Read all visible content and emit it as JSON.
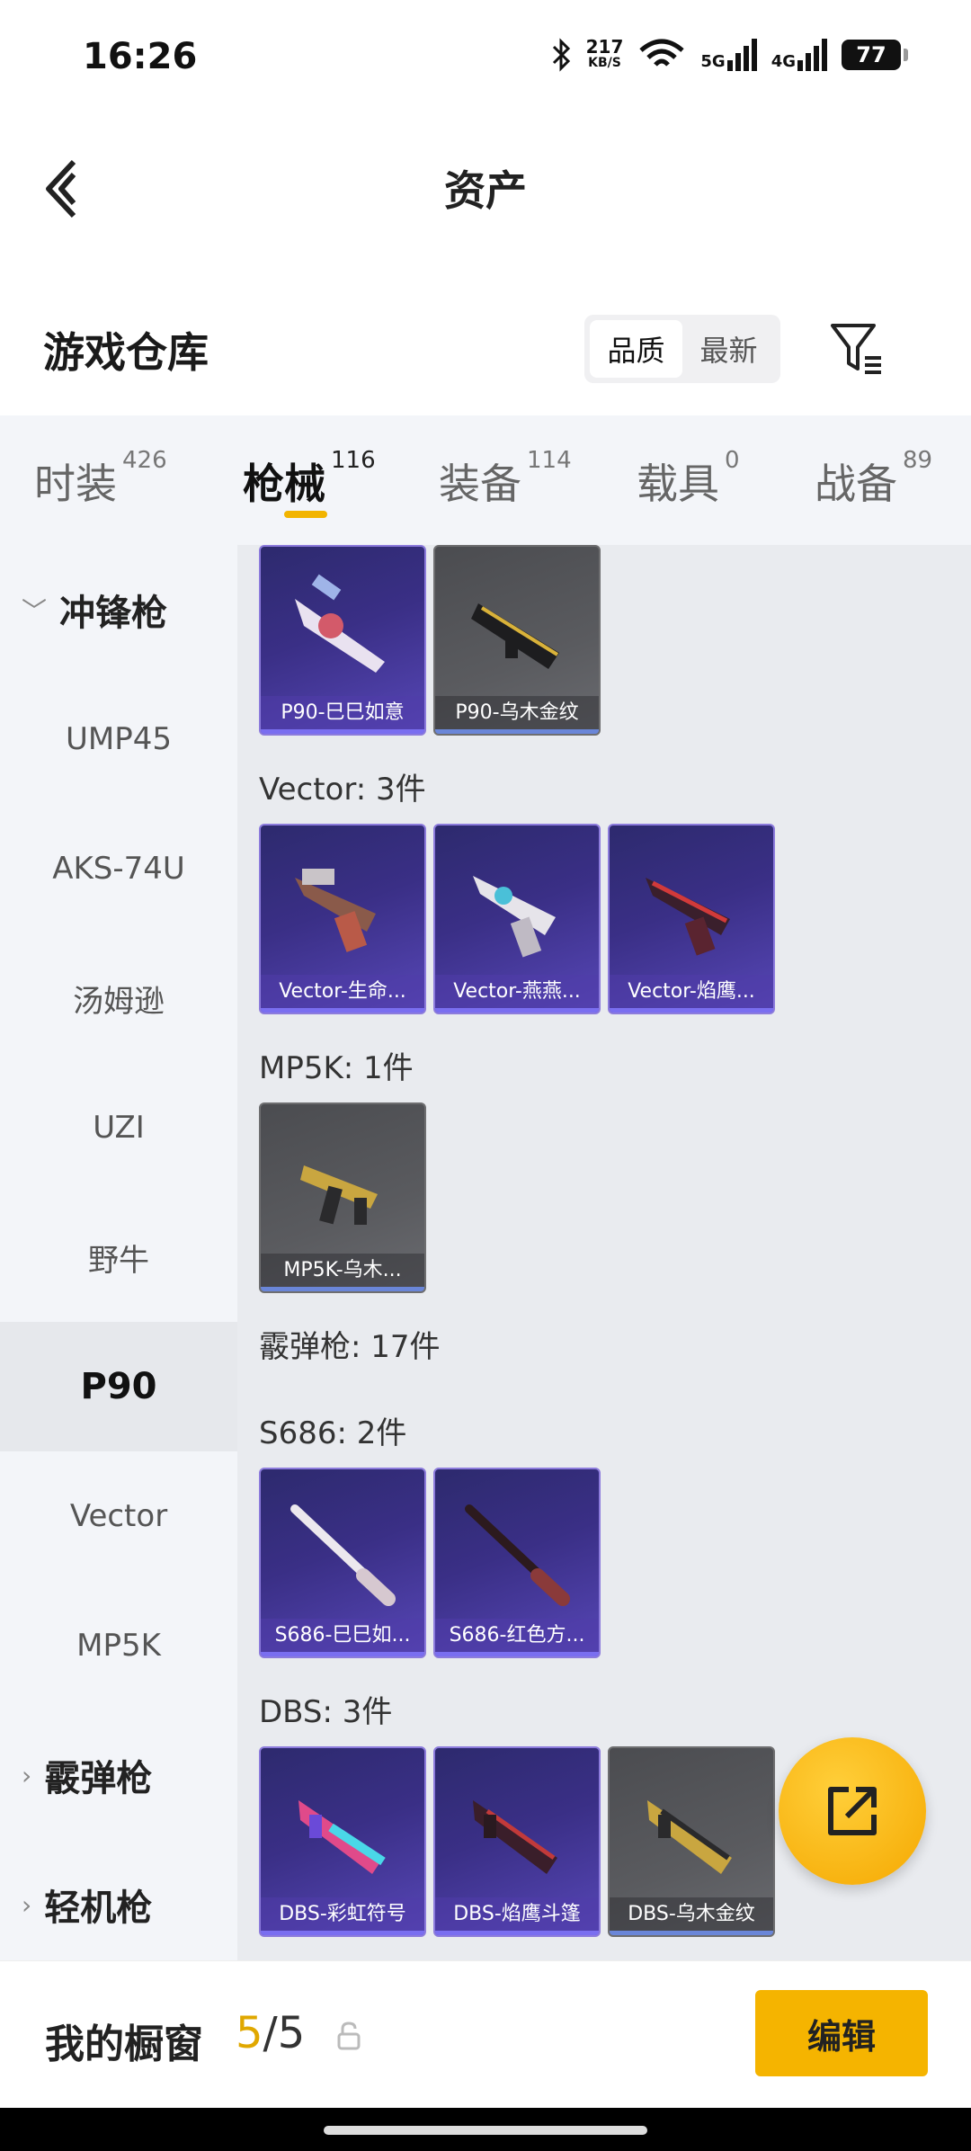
{
  "status_bar": {
    "time": "16:26",
    "net_speed_value": "217",
    "net_speed_unit": "KB/S",
    "signal_5g": "5G",
    "signal_4g": "4G",
    "battery": "77"
  },
  "header": {
    "title": "资产"
  },
  "repository": {
    "title": "游戏仓库",
    "sort_options": [
      "品质",
      "最新"
    ],
    "selected_sort": "品质"
  },
  "tabs": [
    {
      "label": "时装",
      "count": "426"
    },
    {
      "label": "枪械",
      "count": "116"
    },
    {
      "label": "装备",
      "count": "114"
    },
    {
      "label": "载具",
      "count": "0"
    },
    {
      "label": "战备",
      "count": "89"
    }
  ],
  "active_tab": "枪械",
  "sidenav": {
    "items": [
      {
        "label": "冲锋枪",
        "type": "group",
        "expanded": true
      },
      {
        "label": "UMP45",
        "type": "item"
      },
      {
        "label": "AKS-74U",
        "type": "item"
      },
      {
        "label": "汤姆逊",
        "type": "item"
      },
      {
        "label": "UZI",
        "type": "item"
      },
      {
        "label": "野牛",
        "type": "item"
      },
      {
        "label": "P90",
        "type": "item",
        "selected": true
      },
      {
        "label": "Vector",
        "type": "item"
      },
      {
        "label": "MP5K",
        "type": "item"
      },
      {
        "label": "霰弹枪",
        "type": "group",
        "expanded": false
      },
      {
        "label": "轻机枪",
        "type": "group",
        "expanded": false
      }
    ]
  },
  "content": {
    "p90_cards": [
      "P90-巳巳如意",
      "P90-乌木金纹"
    ],
    "vector_group": "Vector: 3件",
    "vector_cards": [
      "Vector-生命...",
      "Vector-燕燕...",
      "Vector-焰鹰..."
    ],
    "mp5k_group": "MP5K: 1件",
    "mp5k_cards": [
      "MP5K-乌木..."
    ],
    "shotgun_group": "霰弹枪: 17件",
    "s686_group": "S686: 2件",
    "s686_cards": [
      "S686-巳巳如...",
      "S686-红色方..."
    ],
    "dbs_group": "DBS: 3件",
    "dbs_cards": [
      "DBS-彩虹符号",
      "DBS-焰鹰斗篷",
      "DBS-乌木金纹"
    ]
  },
  "bottom_bar": {
    "showcase_label": "我的橱窗",
    "showcase_current": "5",
    "showcase_sep": "/",
    "showcase_total": "5",
    "edit_label": "编辑"
  },
  "colors": {
    "accent": "#f5b400",
    "card_purple": "#3a2f86",
    "card_gold_bg": "#5a5b5f"
  }
}
